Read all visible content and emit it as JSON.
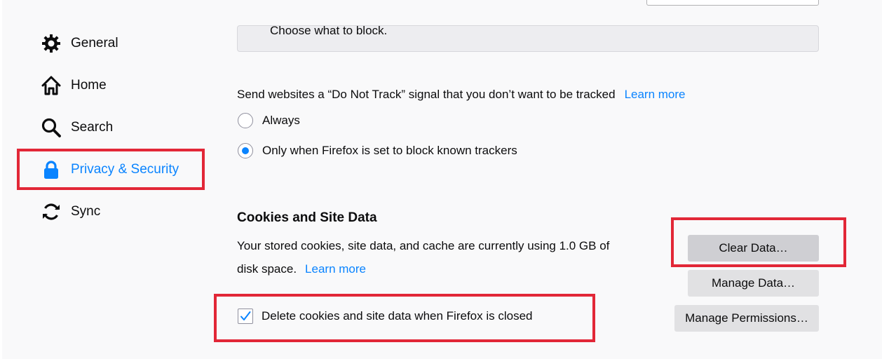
{
  "sidebar": {
    "items": [
      {
        "label": "General",
        "icon": "gear-icon"
      },
      {
        "label": "Home",
        "icon": "home-icon"
      },
      {
        "label": "Search",
        "icon": "search-icon"
      },
      {
        "label": "Privacy & Security",
        "icon": "lock-icon",
        "active": true
      },
      {
        "label": "Sync",
        "icon": "sync-icon"
      }
    ]
  },
  "tracking": {
    "choose_label": "Choose what to block."
  },
  "dnt": {
    "label": "Send websites a “Do Not Track” signal that you don’t want to be tracked",
    "learn_more": "Learn more",
    "options": [
      {
        "label": "Always",
        "checked": false
      },
      {
        "label": "Only when Firefox is set to block known trackers",
        "checked": true
      }
    ]
  },
  "cookies": {
    "heading": "Cookies and Site Data",
    "desc_line1": "Your stored cookies, site data, and cache are currently using 1.0 GB of",
    "desc_line2": "disk space.",
    "learn_more": "Learn more",
    "clear_button": "Clear Data…",
    "manage_button": "Manage Data…",
    "permissions_button": "Manage Permissions…",
    "delete_on_close_label": "Delete cookies and site data when Firefox is closed",
    "delete_on_close_checked": true
  },
  "colors": {
    "accent": "#0a84ff",
    "highlight": "#e22737"
  }
}
